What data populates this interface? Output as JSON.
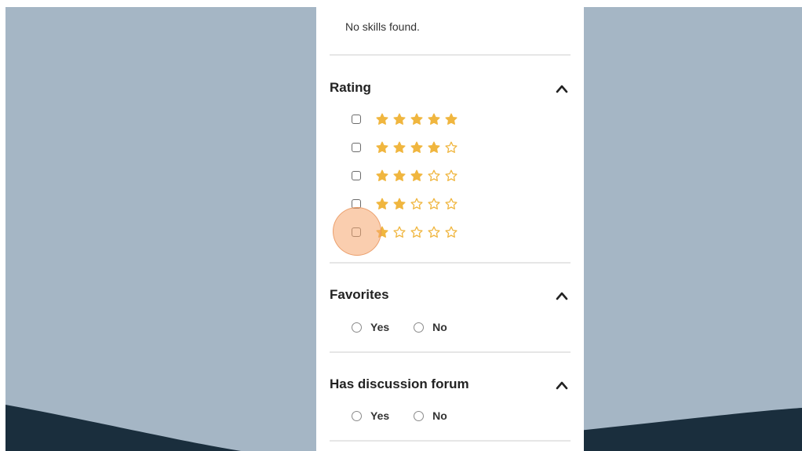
{
  "skills": {
    "empty_text": "No skills found."
  },
  "rating": {
    "title": "Rating",
    "options": [
      {
        "stars": 5
      },
      {
        "stars": 4
      },
      {
        "stars": 3
      },
      {
        "stars": 2
      },
      {
        "stars": 1
      }
    ]
  },
  "favorites": {
    "title": "Favorites",
    "yes_label": "Yes",
    "no_label": "No"
  },
  "discussion_forum": {
    "title": "Has discussion forum",
    "yes_label": "Yes",
    "no_label": "No"
  },
  "colors": {
    "background_slate": "#a5b6c5",
    "wave_navy": "#1a2e3d",
    "star_gold": "#f0b63f",
    "click_highlight": "#f5a66e"
  },
  "icons": {
    "section_toggle": "chevron-up-icon",
    "rating_star": "star-icon"
  }
}
